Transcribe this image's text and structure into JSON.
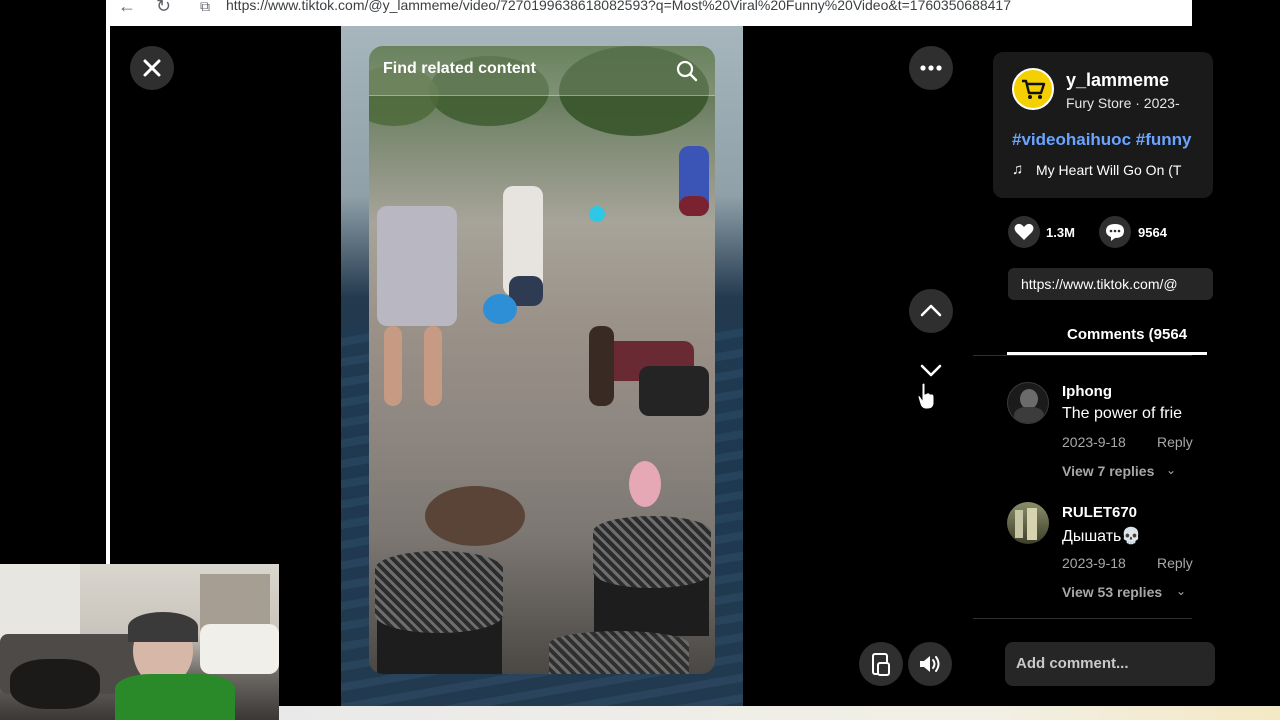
{
  "browser": {
    "url": "https://www.tiktok.com/@y_lammeme/video/7270199638618082593?q=Most%20Viral%20Funny%20Video&t=1760350688417"
  },
  "video": {
    "search_placeholder": "Find related content"
  },
  "author": {
    "username": "y_lammeme",
    "subline": "Fury Store · 2023-",
    "hashtags": "#videohaihuoc #funny",
    "music": "My Heart Will Go On (T"
  },
  "stats": {
    "likes": "1.3M",
    "comments": "9564"
  },
  "share_link": "https://www.tiktok.com/@",
  "comments_tab": "Comments (9564",
  "comments": [
    {
      "user": "Iphong",
      "text": "The power of frie",
      "date": "2023-9-18",
      "reply": "Reply",
      "view_replies": "View 7 replies"
    },
    {
      "user": "RULET670",
      "text": "Дышать💀",
      "date": "2023-9-18",
      "reply": "Reply",
      "view_replies": "View 53 replies"
    }
  ],
  "add_comment": "Add comment...",
  "icons": {
    "close": "close-icon",
    "more": "more-icon",
    "up": "chevron-up-icon",
    "down": "chevron-down-icon",
    "pip": "picture-in-picture-icon",
    "volume": "volume-icon",
    "search": "search-icon",
    "like": "heart-icon",
    "comment": "comment-icon",
    "music": "music-note-icon"
  },
  "colors": {
    "hashtag": "#6aa4ff",
    "avatar_bg": "#f4d000",
    "button_bg": "#2f2f2f"
  }
}
